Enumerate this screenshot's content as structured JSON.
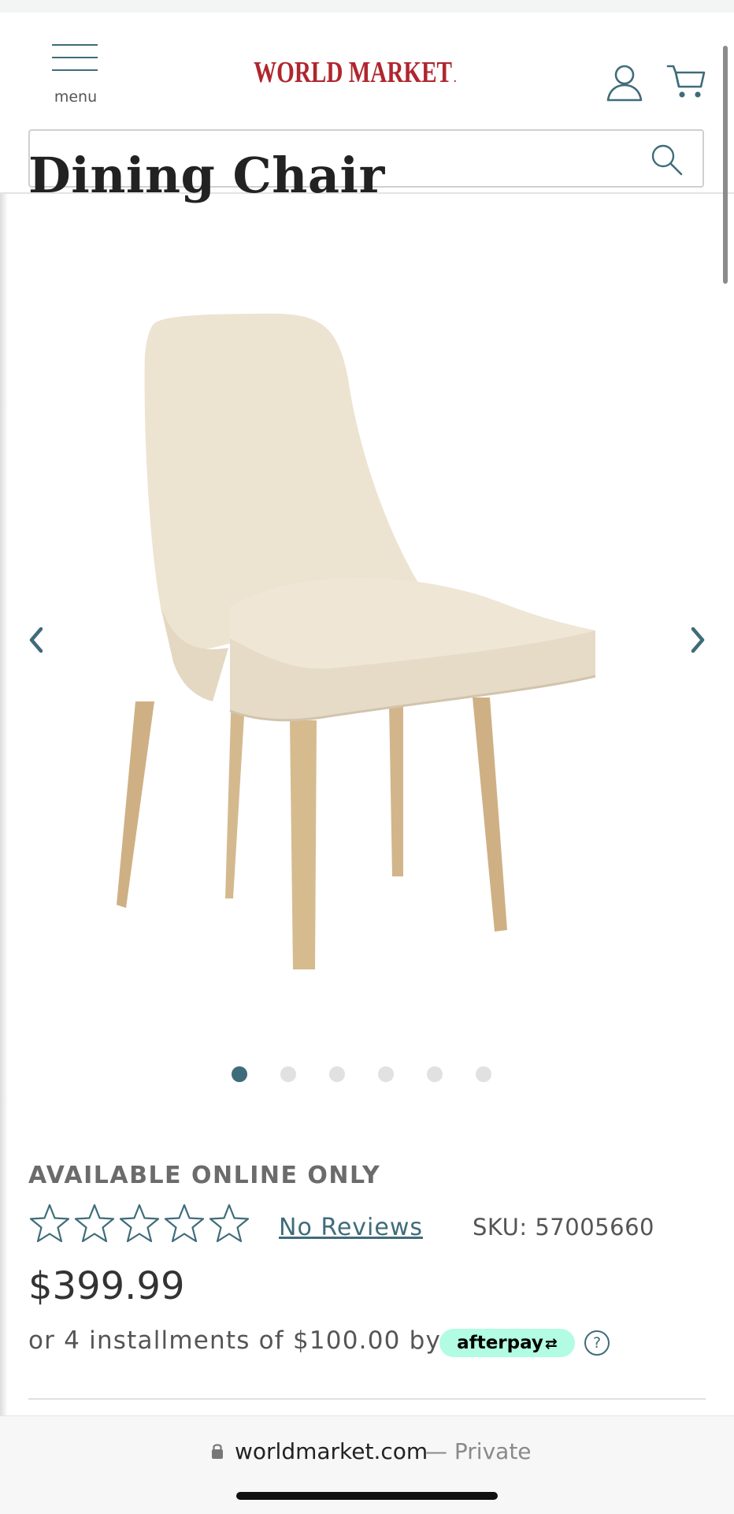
{
  "header": {
    "menu_label": "menu",
    "logo_text": "WORLD MARKET",
    "logo_reg": "."
  },
  "search": {
    "placeholder": ""
  },
  "product": {
    "title": "Dining Chair",
    "availability": "AVAILABLE ONLINE ONLY",
    "rating": 0,
    "rating_max": 5,
    "reviews_label": "No Reviews",
    "sku": "SKU: 57005660",
    "price": "$399.99",
    "installments_text": "or 4 installments of $100.00 by",
    "afterpay_label": "afterpay",
    "info_label": "?"
  },
  "carousel": {
    "image_count": 6,
    "active_index": 0
  },
  "browser": {
    "url": "worldmarket.com",
    "private_label": "— Private"
  },
  "colors": {
    "accent": "#3f6c7a",
    "logo": "#b0262e",
    "afterpay_bg": "#b2fce4"
  }
}
